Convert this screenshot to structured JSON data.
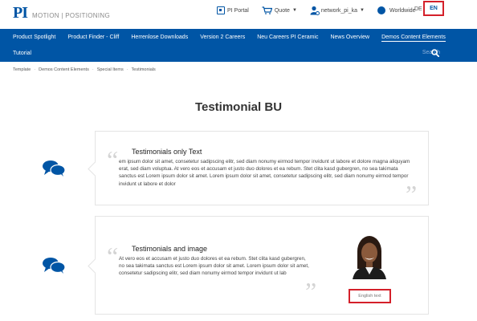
{
  "header": {
    "logo_mark": "PI",
    "logo_tagline": "MOTION | POSITIONING",
    "pi_portal": "PI Portal",
    "quote": "Quote",
    "account": "network_pi_ka",
    "region": "Worldwide",
    "lang_de": "DE",
    "lang_en": "EN"
  },
  "nav": {
    "items": [
      "Product Spotlight",
      "Product Finder - Cliff",
      "Herrenlose Downloads",
      "Version 2 Careers",
      "Neu Careers PI Ceramic",
      "News Overview",
      "Demos Content Elements"
    ],
    "second_row": "Tutorial",
    "search_label": "Search"
  },
  "breadcrumb": [
    "Template",
    "Demos Content Elements",
    "Special Items",
    "Testimonials"
  ],
  "page_title": "Testimonial BU",
  "testimonials": [
    {
      "title": "Testimonials only Text",
      "text": "em ipsum dolor sit amet, consetetur sadipscing elitr, sed diam nonumy eirmod tempor invidunt ut labore et dolore magna aliquyam erat, sed diam voluptua. At vero eos et accusam et justo duo dolores et ea rebum. Stet clita kasd gubergren, no sea takimata sanctus est Lorem ipsum dolor sit amet. Lorem ipsum dolor sit amet, consetetur sadipscing elitr, sed diam nonumy eirmod tempor invidunt ut labore et dolor"
    },
    {
      "title": "Testimonials and image",
      "text": "At vero eos et accusam et justo duo dolores et ea rebum. Stet clita kasd gubergren, no sea takimata sanctus est Lorem ipsum dolor sit amet. Lorem ipsum dolor sit amet, consetetur sadipscing elitr, sed diam nonumy eirmod tempor invidunt ut lab",
      "caption": "English text"
    }
  ],
  "colors": {
    "brand_blue": "#0055a5",
    "highlight_red": "#d4202a",
    "quote_gray": "#d4d4d4"
  },
  "icons": [
    "portal-icon",
    "cart-icon",
    "user-icon",
    "globe-icon",
    "search-icon",
    "chat-bubbles-icon"
  ]
}
